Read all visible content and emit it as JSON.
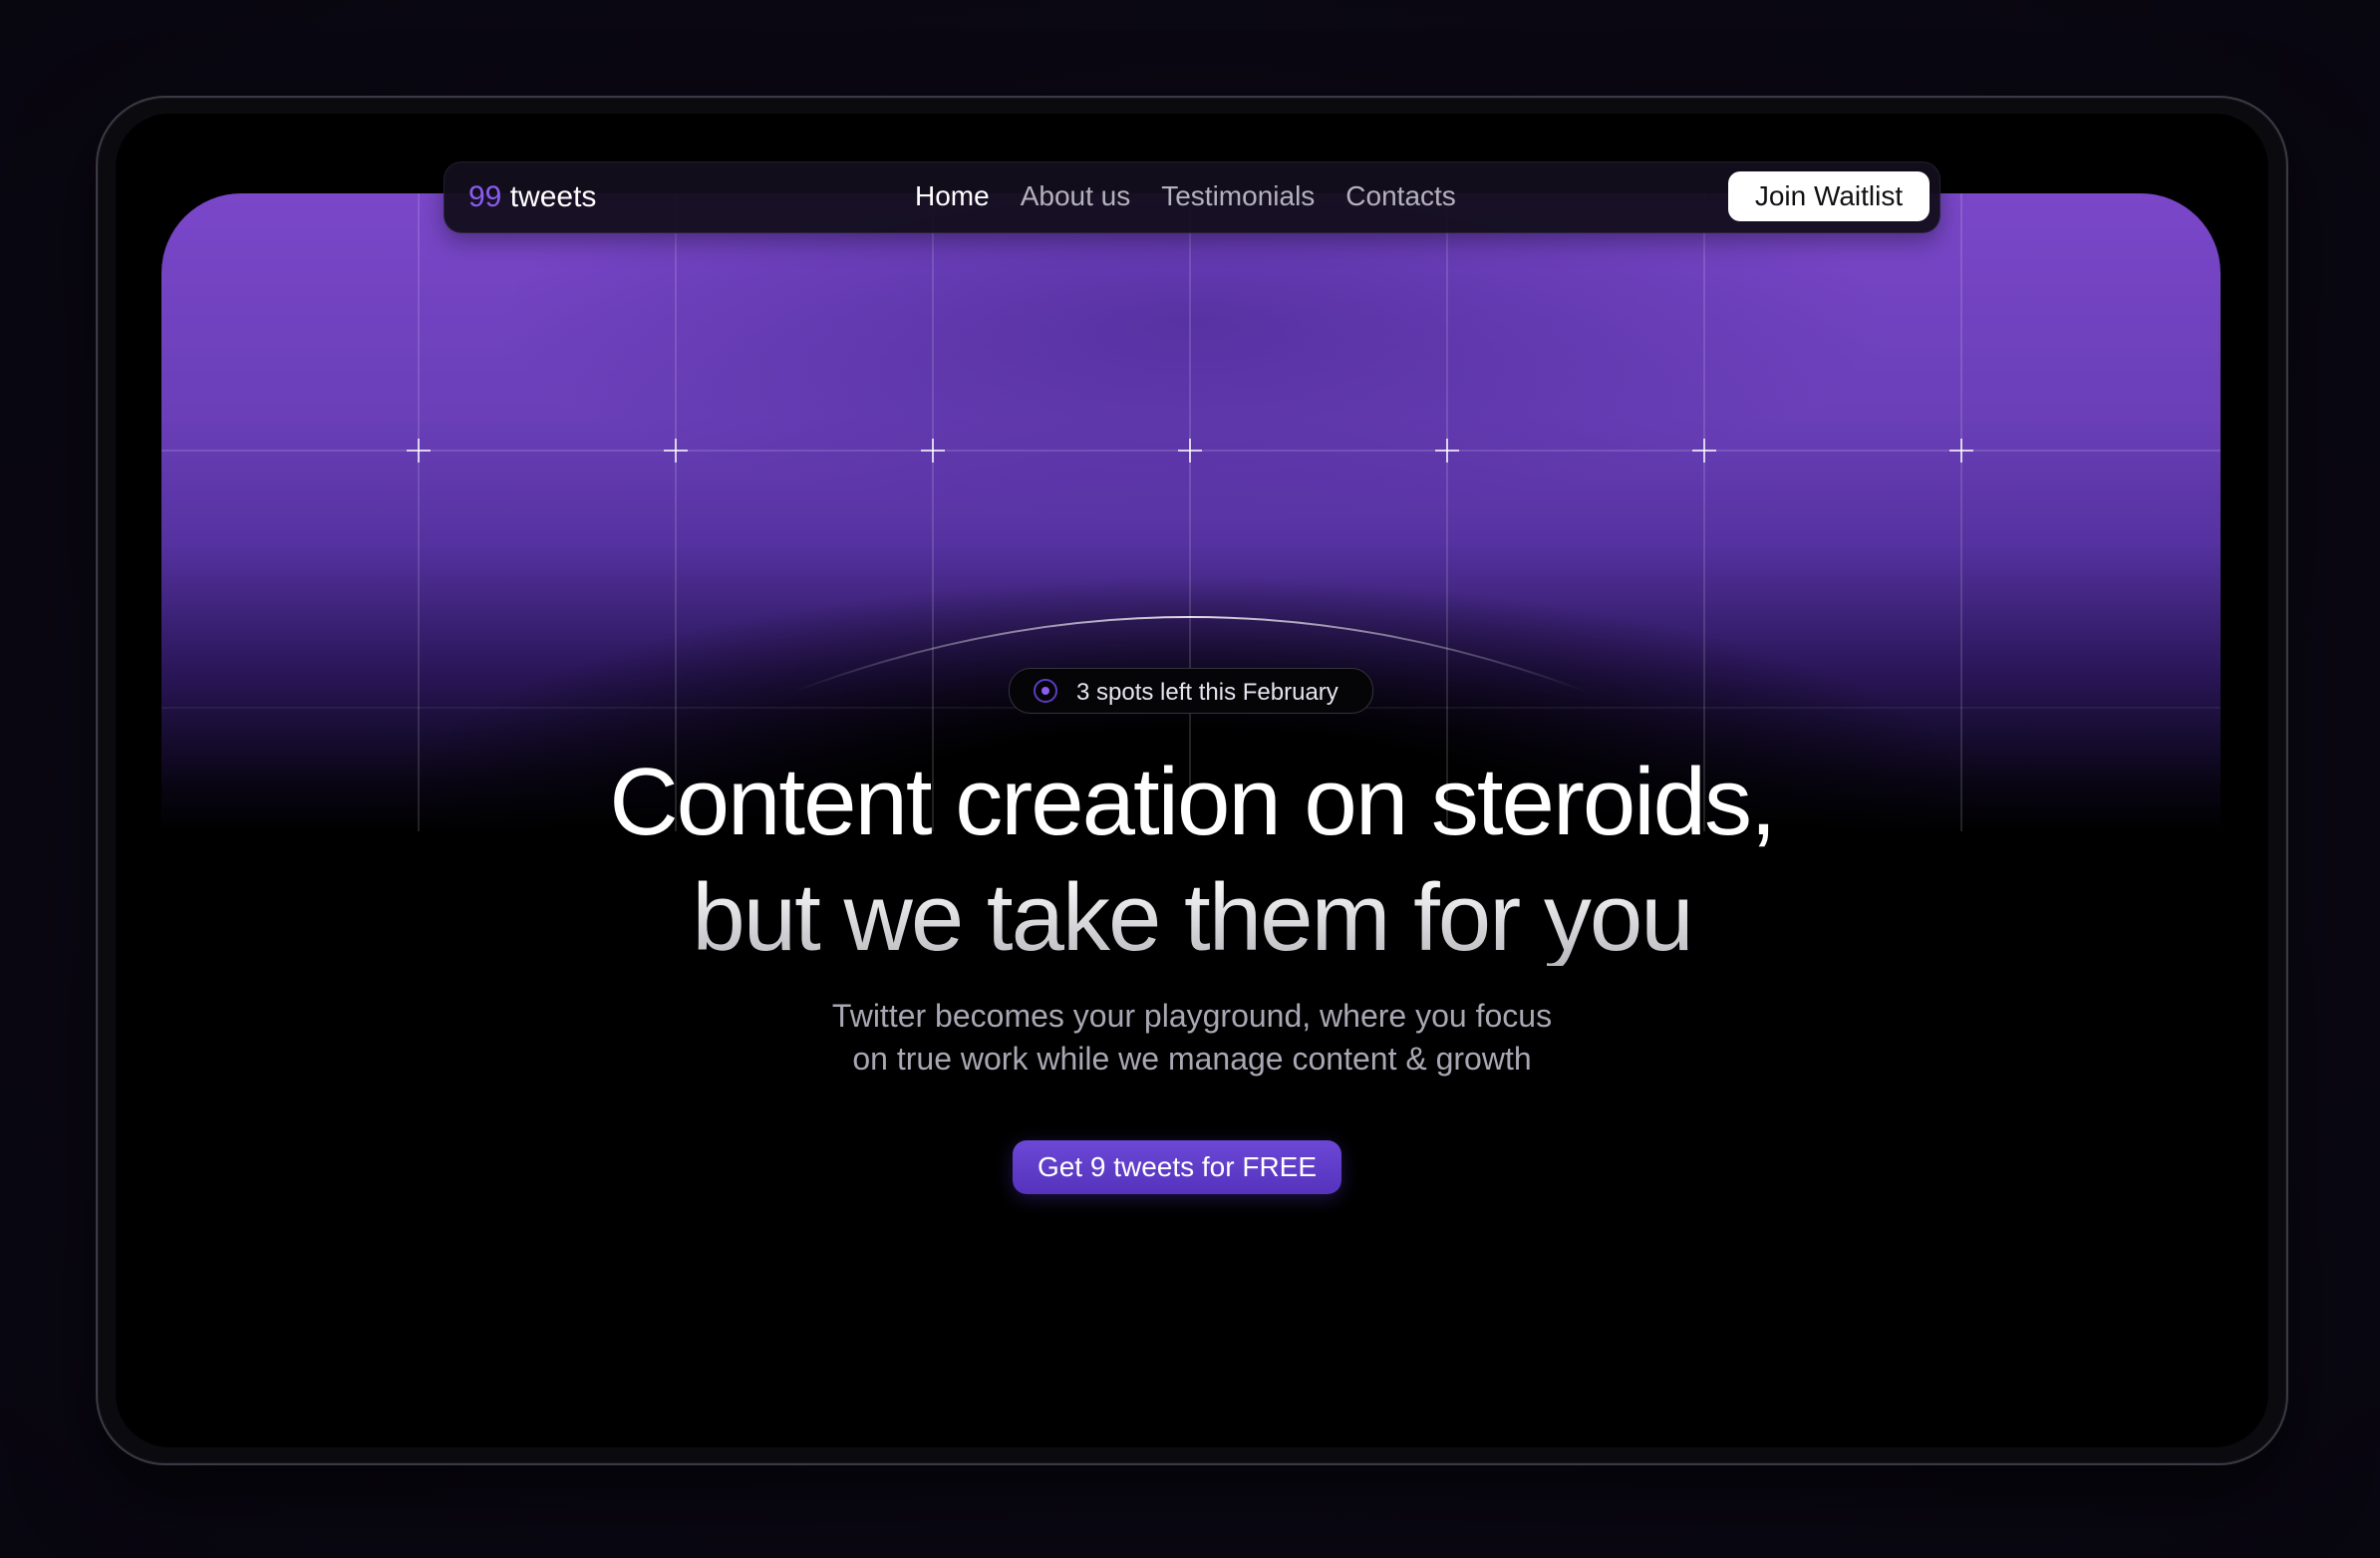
{
  "logo": {
    "number": "99",
    "word": "tweets"
  },
  "nav": {
    "links": [
      {
        "label": "Home",
        "active": true
      },
      {
        "label": "About us",
        "active": false
      },
      {
        "label": "Testimonials",
        "active": false
      },
      {
        "label": "Contacts",
        "active": false
      }
    ],
    "cta_label": "Join Waitlist"
  },
  "hero": {
    "badge_text": "3 spots left this February",
    "headline_line1": "Content creation on steroids,",
    "headline_line2": "but we take them for you",
    "subtitle_line1": "Twitter becomes your playground, where you focus",
    "subtitle_line2": "on true work while we manage content & growth",
    "cta_label": "Get 9 tweets for FREE"
  },
  "colors": {
    "accent": "#8a5cf0",
    "hero_purple": "#7a47c9",
    "cta_purple": "#5f3ecb",
    "background": "#000000"
  },
  "icons": {
    "badge": "radio-dot-icon"
  }
}
